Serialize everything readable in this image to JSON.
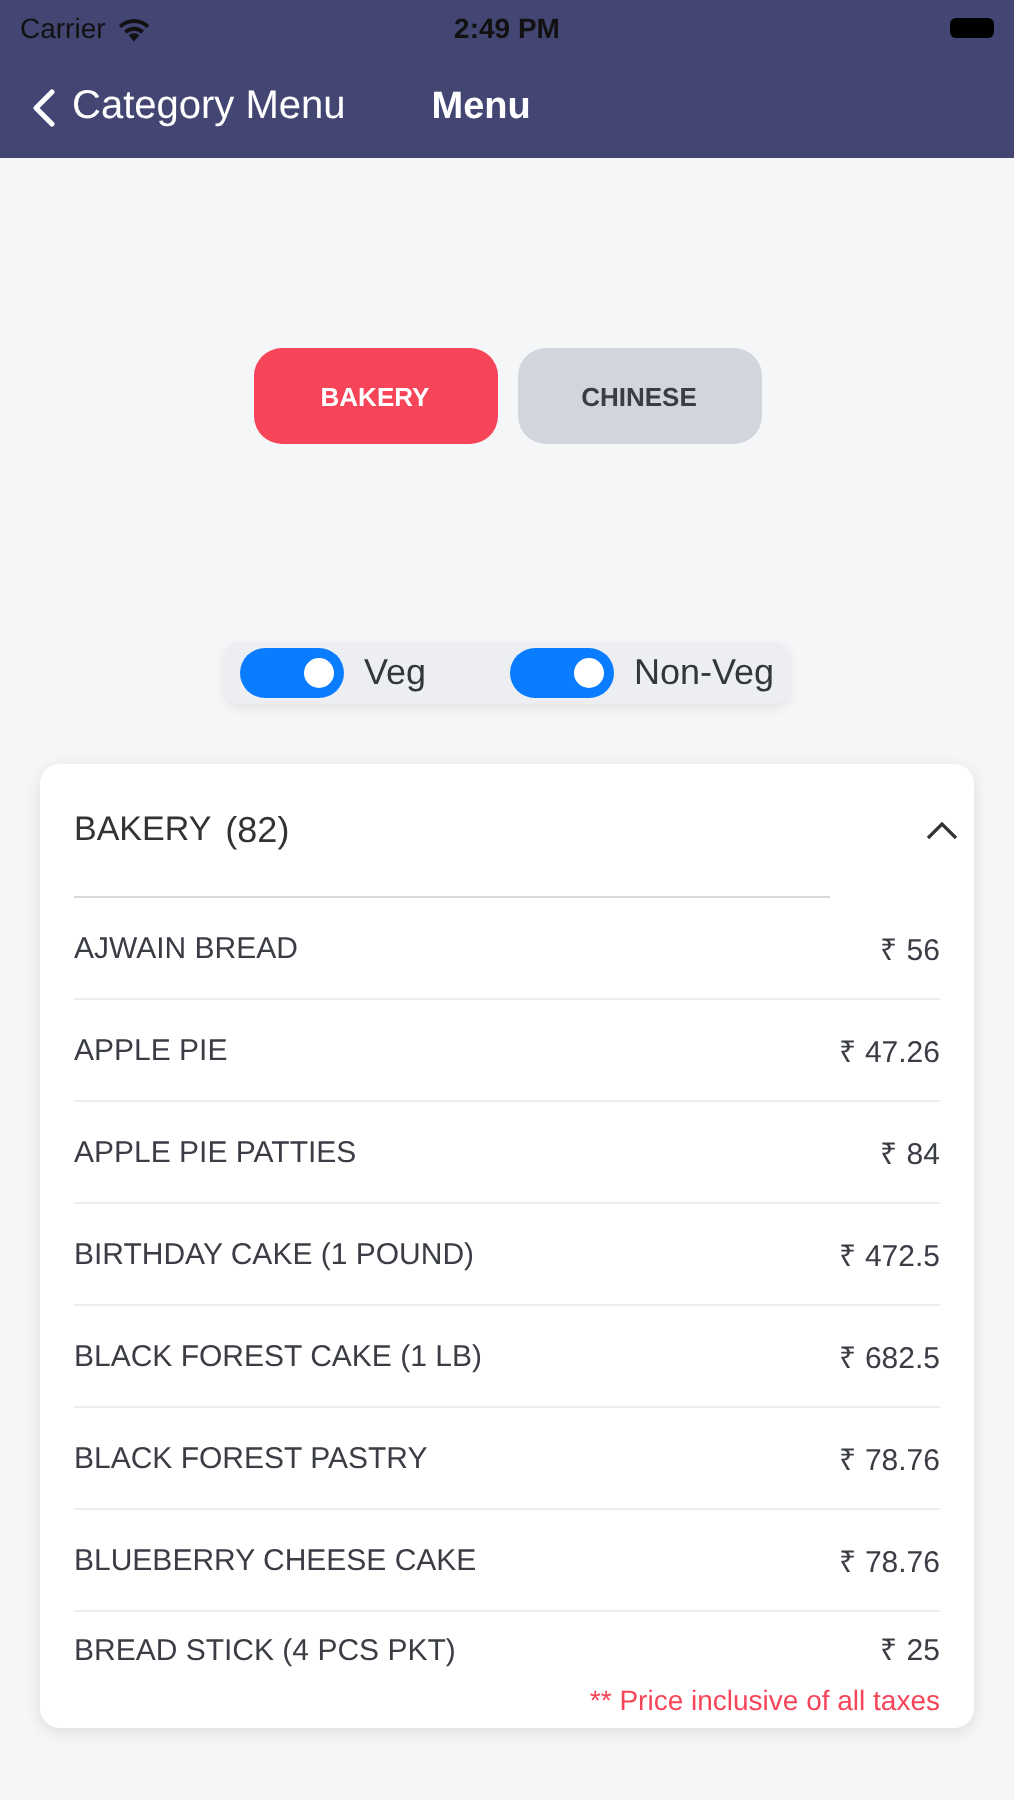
{
  "status_bar": {
    "carrier": "Carrier",
    "time": "2:49 PM"
  },
  "nav_bar": {
    "back_label": "Category Menu",
    "title": "Menu"
  },
  "categories": [
    {
      "label": "BAKERY",
      "selected": true
    },
    {
      "label": "CHINESE",
      "selected": false
    }
  ],
  "filters": [
    {
      "label": "Veg",
      "on": true
    },
    {
      "label": "Non-Veg",
      "on": true
    }
  ],
  "section": {
    "title": "BAKERY",
    "count": "(82)",
    "expanded": true,
    "items": [
      {
        "name": "AJWAIN BREAD",
        "price": "₹ 56"
      },
      {
        "name": "APPLE PIE",
        "price": "₹ 47.26"
      },
      {
        "name": "APPLE PIE PATTIES",
        "price": "₹ 84"
      },
      {
        "name": "BIRTHDAY CAKE (1 POUND)",
        "price": "₹ 472.5"
      },
      {
        "name": "BLACK FOREST CAKE (1 LB)",
        "price": "₹ 682.5"
      },
      {
        "name": "BLACK FOREST PASTRY",
        "price": "₹ 78.76"
      },
      {
        "name": "BLUEBERRY CHEESE CAKE",
        "price": "₹ 78.76"
      },
      {
        "name": "BREAD STICK (4 PCS PKT)",
        "price": "₹ 25"
      }
    ],
    "footnote": "** Price inclusive of all taxes"
  }
}
